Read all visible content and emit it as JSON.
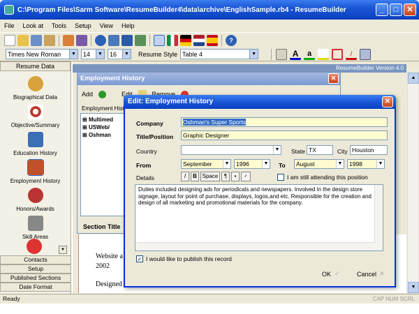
{
  "window": {
    "title": "C:\\Program Files\\Sarm Software\\ResumeBuilder4\\data\\archive\\EnglishSample.rb4 - ResumeBuilder",
    "minimize": "_",
    "maximize": "□",
    "close": "✕"
  },
  "menu": [
    "File",
    "Look at",
    "Tools",
    "Setup",
    "View",
    "Help"
  ],
  "format_toolbar": {
    "font": "Times New Roman",
    "size1": "14",
    "size2": "16",
    "resume_style_label": "Resume Style",
    "resume_style": "Table 4"
  },
  "left_nav": {
    "header": "Resume Data",
    "items": [
      {
        "label": "Biographical Data",
        "icon": "magnifier-icon",
        "color": "#d9a13b"
      },
      {
        "label": "Objective/Summary",
        "icon": "target-icon",
        "color": "#c0392b"
      },
      {
        "label": "Education History",
        "icon": "computer-icon",
        "color": "#3b6fb6"
      },
      {
        "label": "Employment History",
        "icon": "briefcase-icon",
        "color": "#c0522b"
      },
      {
        "label": "Honors/Awards",
        "icon": "star-icon",
        "color": "#b33"
      },
      {
        "label": "Skill Areas",
        "icon": "tools-icon",
        "color": "#777"
      }
    ],
    "bottom": [
      "Contacts",
      "Setup",
      "Published Sections",
      "Date Format"
    ]
  },
  "background": {
    "version_label": "ResumeBuilder  Version 4.0",
    "doc_lines": [
      "Website a",
      "2002",
      "Designed"
    ]
  },
  "employment_window": {
    "title": "Employment History",
    "add": "Add",
    "edit": "Edit",
    "remove": "Remove",
    "tree_label": "Employment Histo",
    "tree_items": [
      "Multimed",
      "USWeb/",
      "Oshman"
    ],
    "section_title": "Section Title"
  },
  "edit_dialog": {
    "title": "Edit:  Employment History",
    "company_label": "Company",
    "company": "Oshman's Super Sports",
    "position_label": "Title/Position",
    "position": "Graphic Designer",
    "country_label": "Country",
    "country": "",
    "state_label": "State",
    "state": "TX",
    "city_label": "City",
    "city": "Houston",
    "from_label": "From",
    "from_month": "September",
    "from_year": "1996",
    "to_label": "To",
    "to_month": "August",
    "to_year": "1998",
    "still_attending": "I am still attending this position",
    "details_label": "Details",
    "fmt_italic": "I",
    "fmt_bold": "B",
    "fmt_space": "Space",
    "fmt_para": "¶",
    "fmt_bullet": "•",
    "details_text": "Duties included designing ads for periodicals and newspapers. Involved in the design store signage, layout for point of purchase, displays, logos,and etc. Responsible for the creation and design of all marketing and promotional materials for the company.",
    "publish_label": "I would like to publish this record",
    "publish_checked": "✓",
    "ok": "OK",
    "cancel": "Cancel"
  },
  "status": {
    "text": "Ready",
    "indicators": "CAP  NUM  SCRL"
  }
}
